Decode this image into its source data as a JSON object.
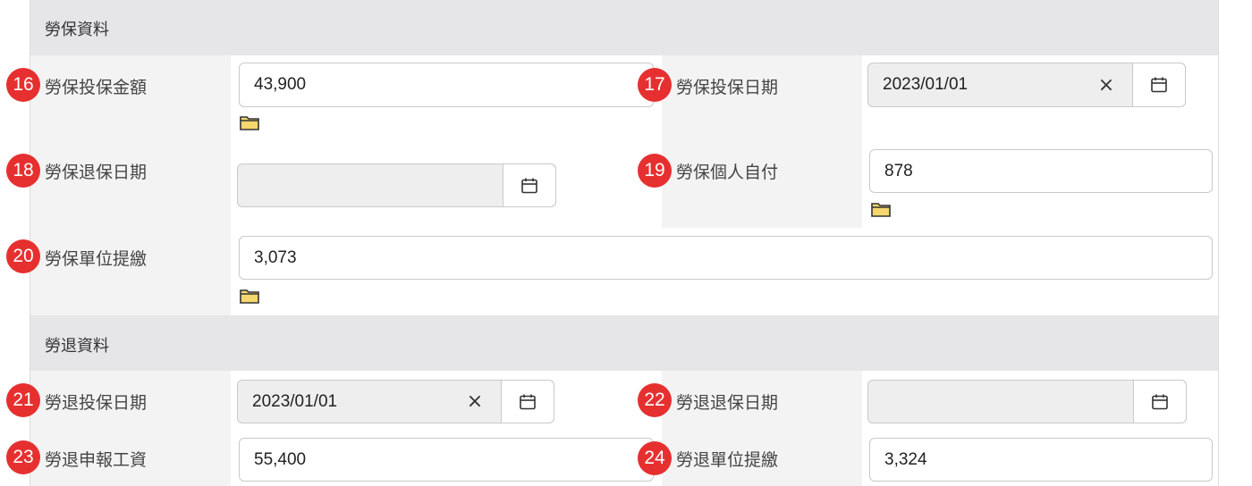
{
  "sections": {
    "labor_insurance": {
      "title": "勞保資料"
    },
    "labor_pension": {
      "title": "勞退資料"
    }
  },
  "fields": {
    "f16": {
      "badge": "16",
      "label": "勞保投保金額",
      "value": "43,900"
    },
    "f17": {
      "badge": "17",
      "label": "勞保投保日期",
      "value": "2023/01/01"
    },
    "f18": {
      "badge": "18",
      "label": "勞保退保日期",
      "value": ""
    },
    "f19": {
      "badge": "19",
      "label": "勞保個人自付",
      "value": "878"
    },
    "f20": {
      "badge": "20",
      "label": "勞保單位提繳",
      "value": "3,073"
    },
    "f21": {
      "badge": "21",
      "label": "勞退投保日期",
      "value": "2023/01/01"
    },
    "f22": {
      "badge": "22",
      "label": "勞退退保日期",
      "value": ""
    },
    "f23": {
      "badge": "23",
      "label": "勞退申報工資",
      "value": "55,400"
    },
    "f24": {
      "badge": "24",
      "label": "勞退單位提繳",
      "value": "3,324"
    }
  },
  "icons": {
    "calendar": "calendar-icon",
    "clear": "close-icon",
    "folder": "folder-icon"
  },
  "colors": {
    "badge": "#e63030",
    "section_header": "#e6e6e8",
    "label_cell": "#f3f3f4",
    "folder": "#f5d76e"
  }
}
